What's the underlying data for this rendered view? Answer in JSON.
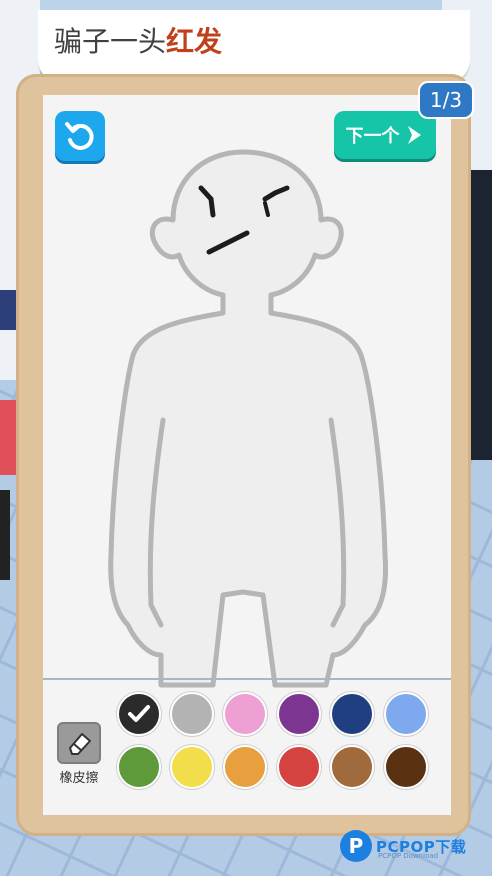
{
  "prompt": {
    "prefix": "骗子一头",
    "highlight": "红发"
  },
  "colors": {
    "highlight": "#c0401c",
    "frame": "#dfc39d",
    "reset_button": "#1da8ee",
    "next_button": "#16c4a8",
    "counter": "#2f78c6"
  },
  "toolbar": {
    "reset_icon": "reset-icon",
    "next_label": "下一个",
    "next_icon": "chevron-right-icon",
    "page_counter": "1/3"
  },
  "palette": {
    "eraser_label": "橡皮擦",
    "eraser_icon": "eraser-icon",
    "selected_index": 0,
    "swatches": [
      {
        "name": "black",
        "hex": "#2b2b2b"
      },
      {
        "name": "gray",
        "hex": "#b3b3b3"
      },
      {
        "name": "pink",
        "hex": "#eea0d4"
      },
      {
        "name": "purple",
        "hex": "#7c3590"
      },
      {
        "name": "navy",
        "hex": "#1f3f82"
      },
      {
        "name": "light-blue",
        "hex": "#7ea9ee"
      },
      {
        "name": "green",
        "hex": "#5e9a3a"
      },
      {
        "name": "yellow",
        "hex": "#f2de4a"
      },
      {
        "name": "orange",
        "hex": "#e8a03e"
      },
      {
        "name": "red",
        "hex": "#d4433f"
      },
      {
        "name": "brown",
        "hex": "#a06a3c"
      },
      {
        "name": "dark-brown",
        "hex": "#5a3212"
      }
    ]
  },
  "watermark": {
    "logo": "P",
    "text": "PCPOP下载",
    "sub": "PCPOP Download"
  }
}
